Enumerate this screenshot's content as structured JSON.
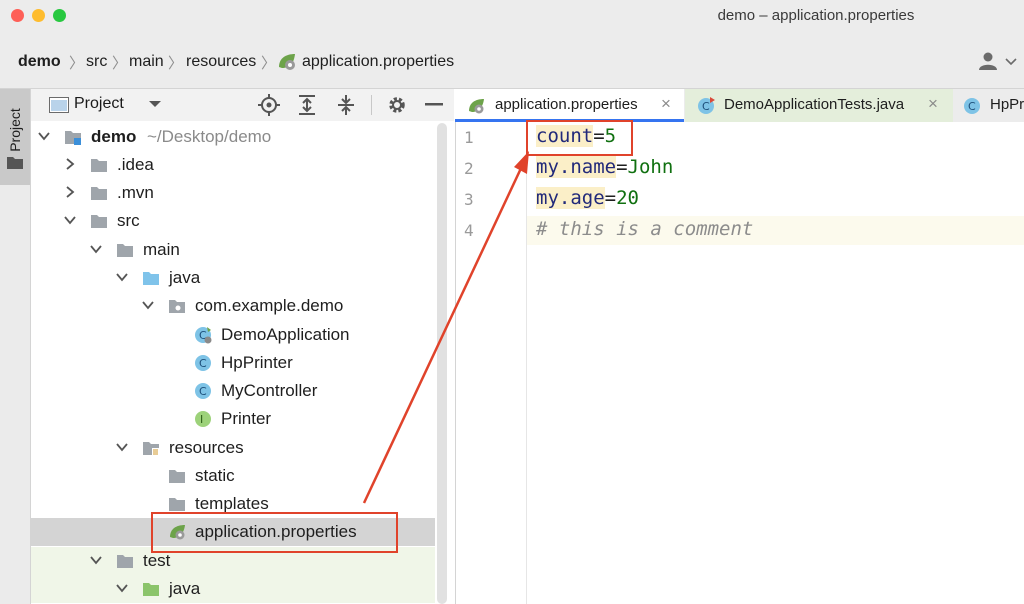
{
  "window": {
    "title": "demo – application.properties"
  },
  "breadcrumb": [
    "demo",
    "src",
    "main",
    "resources",
    "application.properties"
  ],
  "project_panel": {
    "title": "Project"
  },
  "stripe": {
    "label": "Project"
  },
  "tree": [
    {
      "label": "demo",
      "suffix": "~/Desktop/demo"
    },
    {
      "label": ".idea"
    },
    {
      "label": ".mvn"
    },
    {
      "label": "src"
    },
    {
      "label": "main"
    },
    {
      "label": "java"
    },
    {
      "label": "com.example.demo"
    },
    {
      "label": "DemoApplication"
    },
    {
      "label": "HpPrinter"
    },
    {
      "label": "MyController"
    },
    {
      "label": "Printer"
    },
    {
      "label": "resources"
    },
    {
      "label": "static"
    },
    {
      "label": "templates"
    },
    {
      "label": "application.properties"
    },
    {
      "label": "test"
    },
    {
      "label": "java"
    }
  ],
  "tabs": [
    {
      "label": "application.properties"
    },
    {
      "label": "DemoApplicationTests.java"
    },
    {
      "label": "HpPr"
    }
  ],
  "editor": {
    "lines": [
      {
        "num": "1",
        "key": "count",
        "eq": "=",
        "val": "5"
      },
      {
        "num": "2",
        "key": "my.name",
        "eq": "=",
        "val": "John"
      },
      {
        "num": "3",
        "key": "my.age",
        "eq": "=",
        "val": "20"
      },
      {
        "num": "4",
        "comment": "# this is a comment"
      }
    ]
  },
  "colors": {
    "annotation": "#e0432b",
    "accent": "#3574f0"
  }
}
